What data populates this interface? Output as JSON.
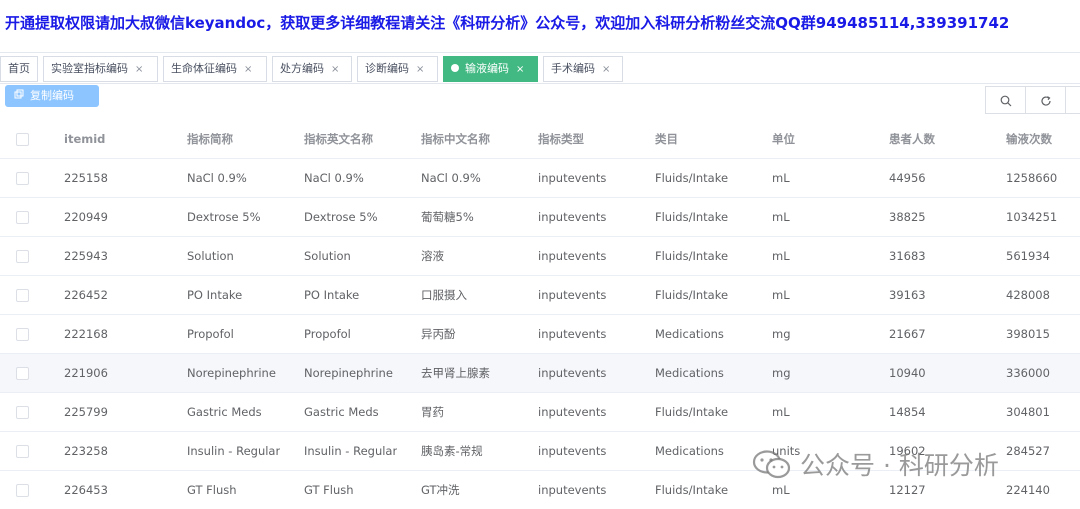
{
  "banner": {
    "text": "开通提取权限请加大叔微信keyandoc，获取更多详细教程请关注《科研分析》公众号，欢迎加入科研分析粉丝交流QQ群949485114,339391742"
  },
  "tabs": [
    {
      "label": "首页",
      "closable": false,
      "active": false
    },
    {
      "label": "实验室指标编码",
      "closable": true,
      "active": false
    },
    {
      "label": "生命体征编码",
      "closable": true,
      "active": false
    },
    {
      "label": "处方编码",
      "closable": true,
      "active": false
    },
    {
      "label": "诊断编码",
      "closable": true,
      "active": false
    },
    {
      "label": "输液编码",
      "closable": true,
      "active": true
    },
    {
      "label": "手术编码",
      "closable": true,
      "active": false
    }
  ],
  "tab_close_glyph": "×",
  "toolbar": {
    "copy_label": "复制编码",
    "copy_icon": "copy-icon",
    "search_icon": "search-icon",
    "refresh_icon": "refresh-icon"
  },
  "table": {
    "headers": [
      "itemid",
      "指标简称",
      "指标英文名称",
      "指标中文名称",
      "指标类型",
      "类目",
      "单位",
      "患者人数",
      "输液次数"
    ],
    "rows": [
      [
        "225158",
        "NaCl 0.9%",
        "NaCl 0.9%",
        "NaCl 0.9%",
        "inputevents",
        "Fluids/Intake",
        "mL",
        "44956",
        "1258660"
      ],
      [
        "220949",
        "Dextrose 5%",
        "Dextrose 5%",
        "葡萄糖5%",
        "inputevents",
        "Fluids/Intake",
        "mL",
        "38825",
        "1034251"
      ],
      [
        "225943",
        "Solution",
        "Solution",
        "溶液",
        "inputevents",
        "Fluids/Intake",
        "mL",
        "31683",
        "561934"
      ],
      [
        "226452",
        "PO Intake",
        "PO Intake",
        "口服摄入",
        "inputevents",
        "Fluids/Intake",
        "mL",
        "39163",
        "428008"
      ],
      [
        "222168",
        "Propofol",
        "Propofol",
        "异丙酚",
        "inputevents",
        "Medications",
        "mg",
        "21667",
        "398015"
      ],
      [
        "221906",
        "Norepinephrine",
        "Norepinephrine",
        "去甲肾上腺素",
        "inputevents",
        "Medications",
        "mg",
        "10940",
        "336000"
      ],
      [
        "225799",
        "Gastric Meds",
        "Gastric Meds",
        "胃药",
        "inputevents",
        "Fluids/Intake",
        "mL",
        "14854",
        "304801"
      ],
      [
        "223258",
        "Insulin - Regular",
        "Insulin - Regular",
        "胰岛素-常规",
        "inputevents",
        "Medications",
        "units",
        "19602",
        "284527"
      ],
      [
        "226453",
        "GT Flush",
        "GT Flush",
        "GT冲洗",
        "inputevents",
        "Fluids/Intake",
        "mL",
        "12127",
        "224140"
      ]
    ],
    "hover_row": 5
  },
  "watermark": {
    "text": "公众号 · 科研分析",
    "icon": "wechat-icon"
  },
  "colors": {
    "banner": "#1a1ae6",
    "active_tab": "#42b983",
    "copy_button": "#8cc5ff",
    "row_hover": "#f5f7fa"
  }
}
